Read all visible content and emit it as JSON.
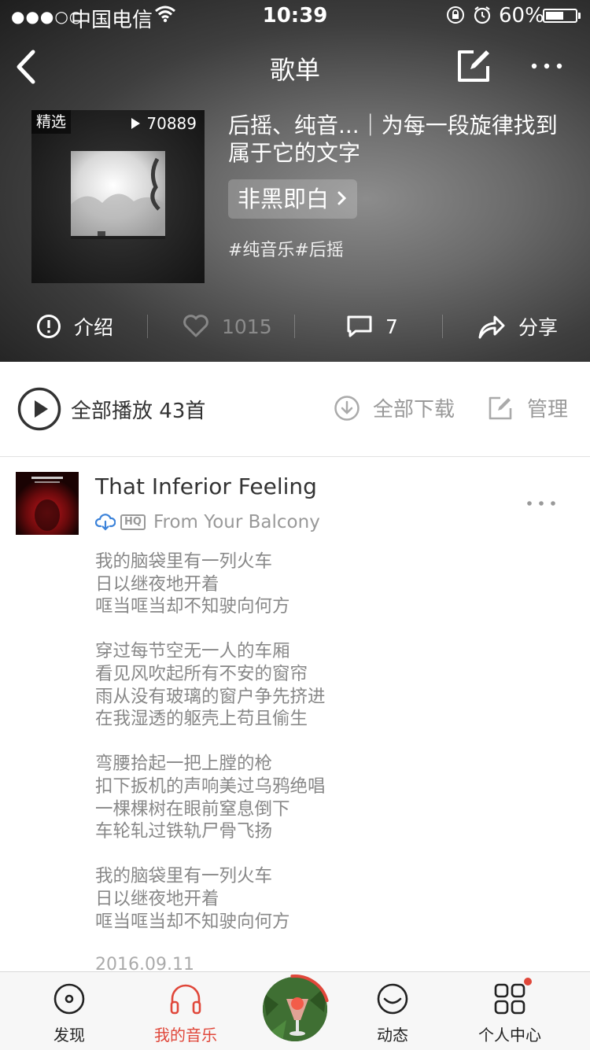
{
  "status_bar": {
    "signal": "●●●○○",
    "carrier": "中国电信",
    "time": "10:39",
    "battery": "60%",
    "battery_level": 0.6
  },
  "nav": {
    "title": "歌单"
  },
  "playlist": {
    "badge": "精选",
    "play_count": "70889",
    "title": "后摇、纯音...｜为每一段旋律找到属于它的文字",
    "creator": "非黑即白",
    "tags": "#纯音乐#后摇"
  },
  "actions": {
    "intro": "介绍",
    "likes": "1015",
    "comments": "7",
    "share": "分享"
  },
  "play_all": {
    "label": "全部播放",
    "count": "43首",
    "download": "全部下载",
    "manage": "管理"
  },
  "song": {
    "title": "That Inferior Feeling",
    "hq": "HQ",
    "album": "From Your Balcony",
    "lyrics": [
      [
        "我的脑袋里有一列火车",
        "日以继夜地开着",
        "哐当哐当却不知驶向何方"
      ],
      [
        "穿过每节空无一人的车厢",
        "看见风吹起所有不安的窗帘",
        "雨从没有玻璃的窗户争先挤进",
        "在我湿透的躯壳上苟且偷生"
      ],
      [
        "弯腰拾起一把上膛的枪",
        "扣下扳机的声响美过乌鸦绝唱",
        "一棵棵树在眼前窒息倒下",
        "车轮轧过铁轨尸骨飞扬"
      ],
      [
        "我的脑袋里有一列火车",
        "日以继夜地开着",
        "哐当哐当却不知驶向何方"
      ]
    ],
    "date": "2016.09.11"
  },
  "tabbar": {
    "discover": "发现",
    "my_music": "我的音乐",
    "friends": "动态",
    "account": "个人中心",
    "active_color": "#e0473a"
  }
}
